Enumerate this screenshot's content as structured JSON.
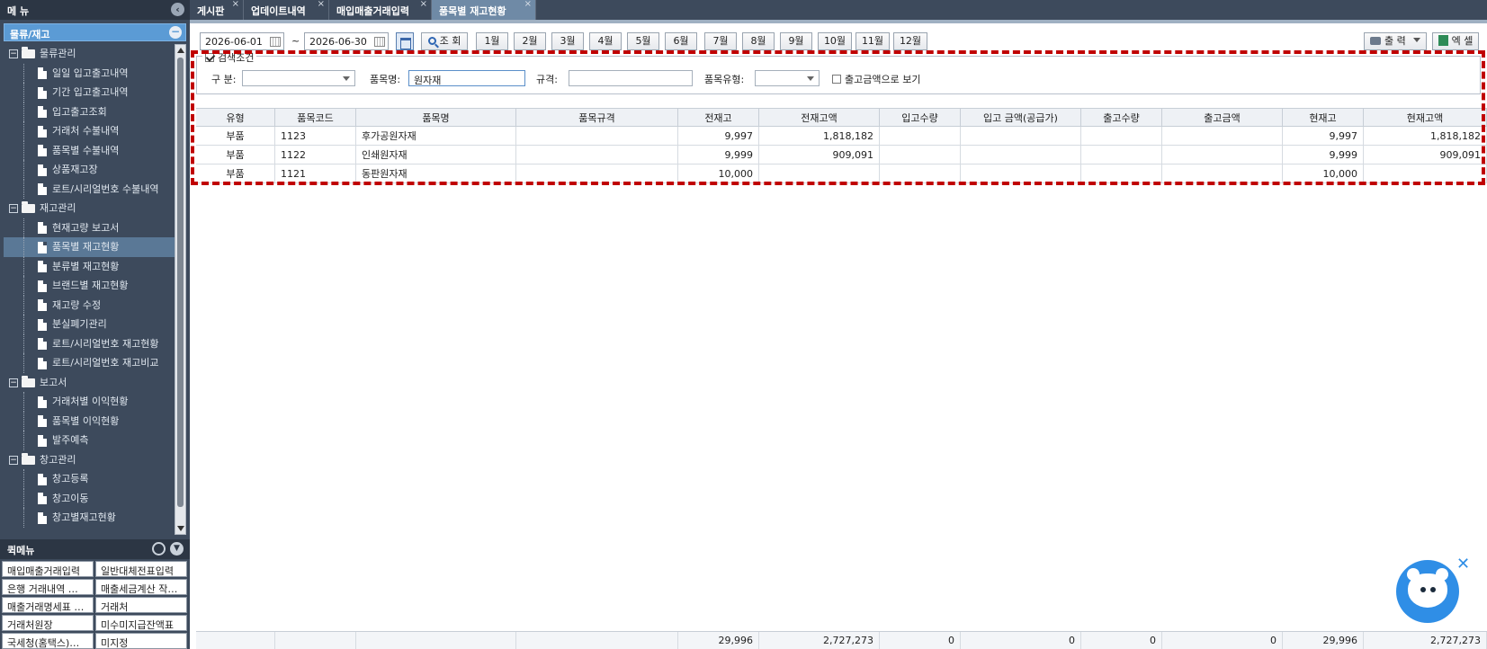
{
  "menu": {
    "title": "메 뉴",
    "category": "물류/재고",
    "tree": [
      {
        "type": "folder",
        "label": "물류관리"
      },
      {
        "type": "leaf",
        "label": "일일 입고출고내역"
      },
      {
        "type": "leaf",
        "label": "기간 입고출고내역"
      },
      {
        "type": "leaf",
        "label": "입고출고조회"
      },
      {
        "type": "leaf",
        "label": "거래처 수불내역"
      },
      {
        "type": "leaf",
        "label": "품목별 수불내역"
      },
      {
        "type": "leaf",
        "label": "상품재고장"
      },
      {
        "type": "leaf",
        "label": "로트/시리얼번호 수불내역"
      },
      {
        "type": "folder",
        "label": "재고관리"
      },
      {
        "type": "leaf",
        "label": "현재고량 보고서"
      },
      {
        "type": "leaf",
        "label": "품목별 재고현황",
        "selected": true
      },
      {
        "type": "leaf",
        "label": "분류별 재고현황"
      },
      {
        "type": "leaf",
        "label": "브랜드별 재고현황"
      },
      {
        "type": "leaf",
        "label": "재고량 수정"
      },
      {
        "type": "leaf",
        "label": "분실폐기관리"
      },
      {
        "type": "leaf",
        "label": "로트/시리얼번호 재고현황"
      },
      {
        "type": "leaf",
        "label": "로트/시리얼번호 재고비교"
      },
      {
        "type": "folder",
        "label": "보고서"
      },
      {
        "type": "leaf",
        "label": "거래처별 이익현황"
      },
      {
        "type": "leaf",
        "label": "품목별 이익현황"
      },
      {
        "type": "leaf",
        "label": "발주예측"
      },
      {
        "type": "folder",
        "label": "창고관리"
      },
      {
        "type": "leaf",
        "label": "창고등록"
      },
      {
        "type": "leaf",
        "label": "창고이동"
      },
      {
        "type": "leaf",
        "label": "창고별재고현황"
      }
    ]
  },
  "quickmenu": {
    "title": "퀵메뉴",
    "items": [
      "매입매출거래입력",
      "일반대체전표입력",
      "은행 거래내역 …",
      "매출세금계산 작…",
      "매출거래명세표 …",
      "거래처",
      "거래처원장",
      "미수미지급잔액표",
      "국세청(홈택스)…",
      "미지정"
    ]
  },
  "tabs": [
    {
      "label": "게시판"
    },
    {
      "label": "업데이트내역"
    },
    {
      "label": "매입매출거래입력"
    },
    {
      "label": "품목별 재고현황",
      "active": true
    }
  ],
  "toolbar": {
    "date_from": "2026-06-01",
    "tilde": "~",
    "date_to": "2026-06-30",
    "search_label": "조 회",
    "months": [
      "1월",
      "2월",
      "3월",
      "4월",
      "5월",
      "6월",
      "7월",
      "8월",
      "9월",
      "10월",
      "11월",
      "12월"
    ],
    "print_label": "출 력",
    "excel_label": "엑 셀"
  },
  "filters": {
    "legend": "검색조건",
    "category_label": "구 분:",
    "category_value": "",
    "item_name_label": "품목명:",
    "item_name_value": "원자재",
    "spec_label": "규격:",
    "spec_value": "",
    "item_type_label": "품목유형:",
    "item_type_value": "",
    "view_outgoing_amount_label": "출고금액으로 보기"
  },
  "table": {
    "columns": [
      "유형",
      "품목코드",
      "품목명",
      "품목규격",
      "전재고",
      "전재고액",
      "입고수량",
      "입고 금액(공급가)",
      "출고수량",
      "출고금액",
      "현재고",
      "현재고액"
    ],
    "rows": [
      [
        "부품",
        "1123",
        "후가공원자재",
        "",
        "9,997",
        "1,818,182",
        "",
        "",
        "",
        "",
        "9,997",
        "1,818,182"
      ],
      [
        "부품",
        "1122",
        "인쇄원자재",
        "",
        "9,999",
        "909,091",
        "",
        "",
        "",
        "",
        "9,999",
        "909,091"
      ],
      [
        "부품",
        "1121",
        "동판원자재",
        "",
        "10,000",
        "",
        "",
        "",
        "",
        "",
        "10,000",
        ""
      ]
    ],
    "totals": [
      "",
      "",
      "",
      "",
      "29,996",
      "2,727,273",
      "0",
      "0",
      "0",
      "0",
      "29,996",
      "2,727,273"
    ]
  },
  "colors": {
    "annotation_dashed": "#c00000",
    "menu_bg": "#3d4a5c",
    "accent": "#5b9bd5"
  }
}
